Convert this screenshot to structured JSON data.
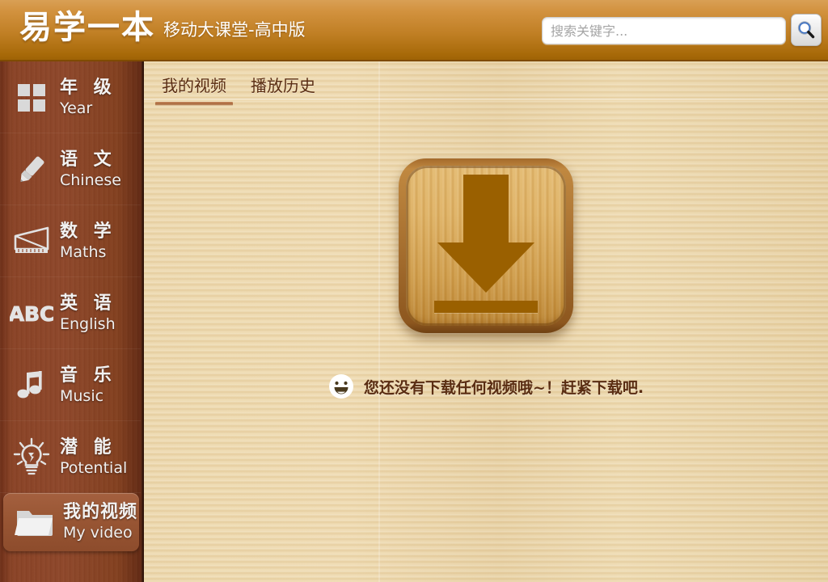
{
  "header": {
    "logo_main": "易学一本",
    "logo_sub": "移动大课堂-高中版",
    "search_placeholder": "搜索关键字...",
    "search_value": "",
    "search_button_icon": "search-icon",
    "bg_gradient_from": "#d9a055",
    "bg_gradient_to": "#9c6104"
  },
  "sidebar": {
    "items": [
      {
        "cn": "年 级",
        "en": "Year",
        "icon": "grid-icon",
        "active": false
      },
      {
        "cn": "语 文",
        "en": "Chinese",
        "icon": "pencil-icon",
        "active": false
      },
      {
        "cn": "数 学",
        "en": "Maths",
        "icon": "ruler-icon",
        "active": false
      },
      {
        "cn": "英 语",
        "en": "English",
        "icon": "abc-icon",
        "active": false
      },
      {
        "cn": "音 乐",
        "en": "Music",
        "icon": "music-note-icon",
        "active": false
      },
      {
        "cn": "潜 能",
        "en": "Potential",
        "icon": "lightbulb-icon",
        "active": false
      },
      {
        "cn": "我的视频",
        "en": "My video",
        "icon": "folder-icon",
        "active": true
      }
    ],
    "bg_color": "#8a4326",
    "active_bg_color": "#9a5735"
  },
  "main": {
    "tabs": [
      {
        "label": "我的视频",
        "active": true
      },
      {
        "label": "播放历史",
        "active": false
      }
    ],
    "empty_state": {
      "icon": "download-icon",
      "smiley_icon": "smiley-face-icon",
      "message": "您还没有下载任何视频哦~！赶紧下载吧.",
      "text_color": "#5a2d12"
    },
    "bg_color": "#ecd7ab"
  }
}
